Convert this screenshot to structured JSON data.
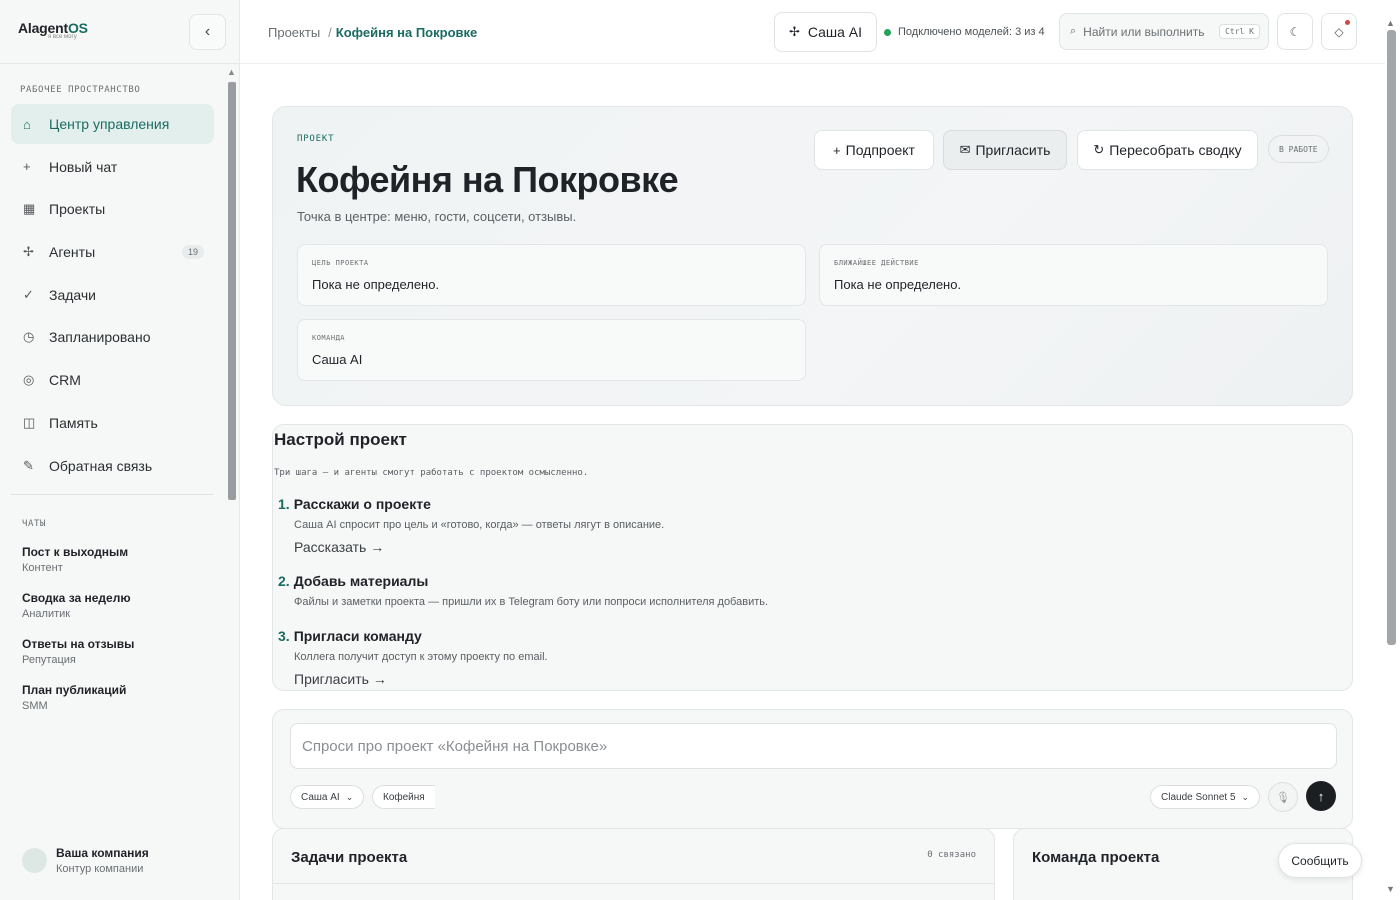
{
  "brand": {
    "name_main": "Alagent",
    "name_accent": "OS",
    "tagline": "я все могу",
    "collapse_icon": "‹"
  },
  "sidebar": {
    "workspace_label": "РАБОЧЕЕ ПРОСТРАНСТВО",
    "nav": [
      {
        "icon": "home-icon",
        "glyph": "⌂",
        "label": "Центр управления",
        "active": true
      },
      {
        "icon": "plus-icon",
        "glyph": "+",
        "label": "Новый чат"
      },
      {
        "icon": "grid-icon",
        "glyph": "▦",
        "label": "Проекты"
      },
      {
        "icon": "agents-icon",
        "glyph": "✢",
        "label": "Агенты",
        "badge": "19"
      },
      {
        "icon": "check-icon",
        "glyph": "✓",
        "label": "Задачи"
      },
      {
        "icon": "clock-icon",
        "glyph": "◷",
        "label": "Запланировано"
      },
      {
        "icon": "crm-icon",
        "glyph": "◎",
        "label": "CRM"
      },
      {
        "icon": "book-icon",
        "glyph": "◫",
        "label": "Память"
      },
      {
        "icon": "pen-icon",
        "glyph": "✎",
        "label": "Обратная связь"
      }
    ],
    "chats_label": "ЧАТЫ",
    "chats": [
      {
        "title": "Пост к выходным",
        "sub": "Контент"
      },
      {
        "title": "Сводка за неделю",
        "sub": "Аналитик"
      },
      {
        "title": "Ответы на отзывы",
        "sub": "Репутация"
      },
      {
        "title": "План публикаций",
        "sub": "SMM"
      }
    ],
    "company": {
      "name": "Ваша компания",
      "sub": "Контур компании"
    }
  },
  "topbar": {
    "crumb_root": "Проекты",
    "crumb_sep": "/",
    "crumb_current": "Кофейня на Покровке",
    "agent_icon": "✢",
    "agent_label": "Саша AI",
    "connection": "Подключено моделей: 3 из 4",
    "connection_color": "#22a35a",
    "search_icon": "⌕",
    "search_placeholder": "Найти или выполнить",
    "search_kbd": "Ctrl K",
    "theme_icon": "☾",
    "notify_icon": "◇"
  },
  "hero": {
    "kicker": "ПРОЕКТ",
    "title": "Кофейня на Покровке",
    "description": "Точка в центре: меню, гости, соцсети, отзывы.",
    "btn_subproject": "Подпроект",
    "btn_subproject_icon": "+",
    "btn_invite": "Пригласить",
    "btn_invite_icon": "✉",
    "btn_rebuild": "Пересобрать сводку",
    "btn_rebuild_icon": "↻",
    "status": "В РАБОТЕ",
    "goal_label": "ЦЕЛЬ ПРОЕКТА",
    "goal_value": "Пока не определено.",
    "next_label": "БЛИЖАЙШЕЕ ДЕЙСТВИЕ",
    "next_value": "Пока не определено.",
    "team_label": "КОМАНДА",
    "team_value": "Саша AI"
  },
  "setup": {
    "title": "Настрой проект",
    "subtitle": "Три шага — и агенты смогут работать с проектом осмысленно.",
    "steps": [
      {
        "num": "1.",
        "title": "Расскажи о проекте",
        "desc": "Саша AI спросит про цель и «готово, когда» — ответы лягут в описание.",
        "link": "Рассказать →"
      },
      {
        "num": "2.",
        "title": "Добавь материалы",
        "desc": "Файлы и заметки проекта — пришли их в Telegram боту или попроси исполнителя добавить."
      },
      {
        "num": "3.",
        "title": "Пригласи команду",
        "desc": "Коллега получит доступ к этому проекту по email.",
        "link": "Пригласить →"
      }
    ]
  },
  "composer": {
    "placeholder": "Спроси про проект «Кофейня на Покровке»",
    "agent_select": "Саша AI",
    "context_chip": "Кофейня",
    "model_select": "Claude Sonnet 5",
    "mic_icon": "🎙",
    "send_icon": "↑"
  },
  "tasks": {
    "title": "Задачи проекта",
    "count": "0 связано"
  },
  "team": {
    "title": "Команда проекта"
  },
  "report_button": "Сообщить"
}
